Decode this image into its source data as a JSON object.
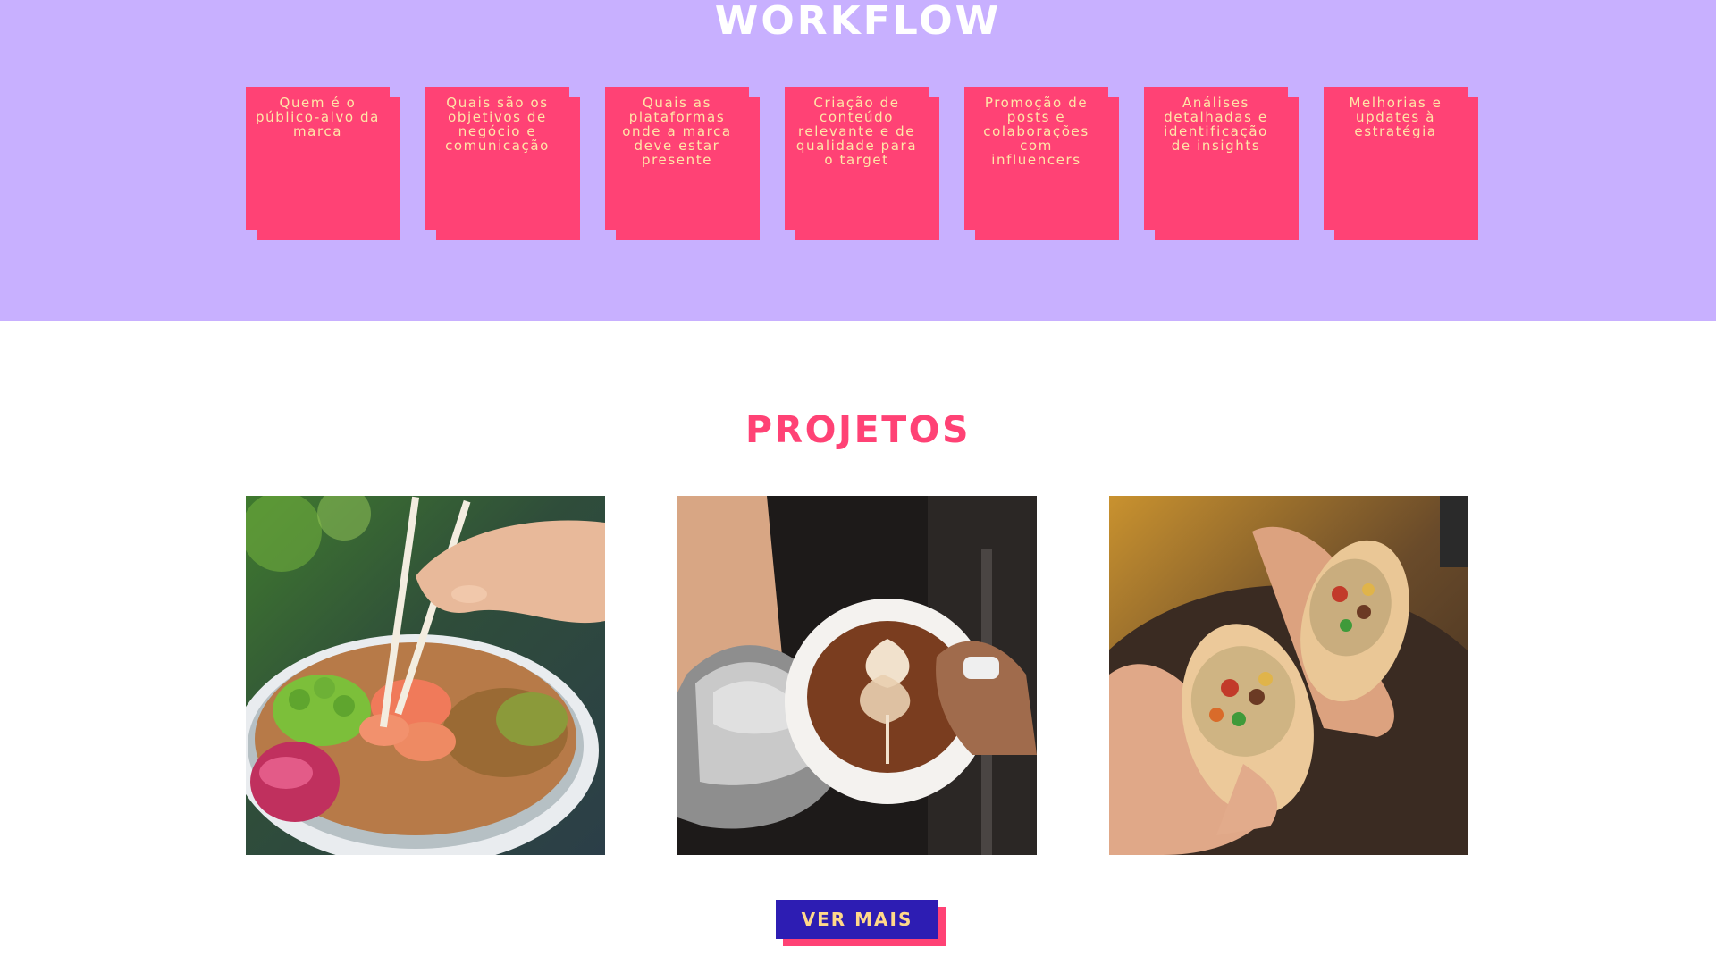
{
  "workflow": {
    "title": "WORKFLOW",
    "steps": [
      {
        "label": "Quem é o público-alvo da marca"
      },
      {
        "label": "Quais são os objetivos de negócio e comunicação"
      },
      {
        "label": "Quais as plataformas onde a marca deve estar presente"
      },
      {
        "label": "Criação de conteúdo relevante e de qualidade para o target"
      },
      {
        "label": "Promoção de posts e colaborações com influencers"
      },
      {
        "label": "Análises detalhadas e identificação de insights"
      },
      {
        "label": "Melhorias e updates à estratégia"
      }
    ]
  },
  "projects": {
    "title": "PROJETOS",
    "images": [
      {
        "subject": "poke-bowl-photo"
      },
      {
        "subject": "latte-art-photo"
      },
      {
        "subject": "burrito-photo"
      }
    ],
    "cta_label": "VER MAIS"
  },
  "colors": {
    "workflow_background": "#c8b0ff",
    "accent_pink": "#ff4275",
    "step_text": "#ffe6a8",
    "button_background": "#2d1db3",
    "button_text": "#ffd98a"
  }
}
